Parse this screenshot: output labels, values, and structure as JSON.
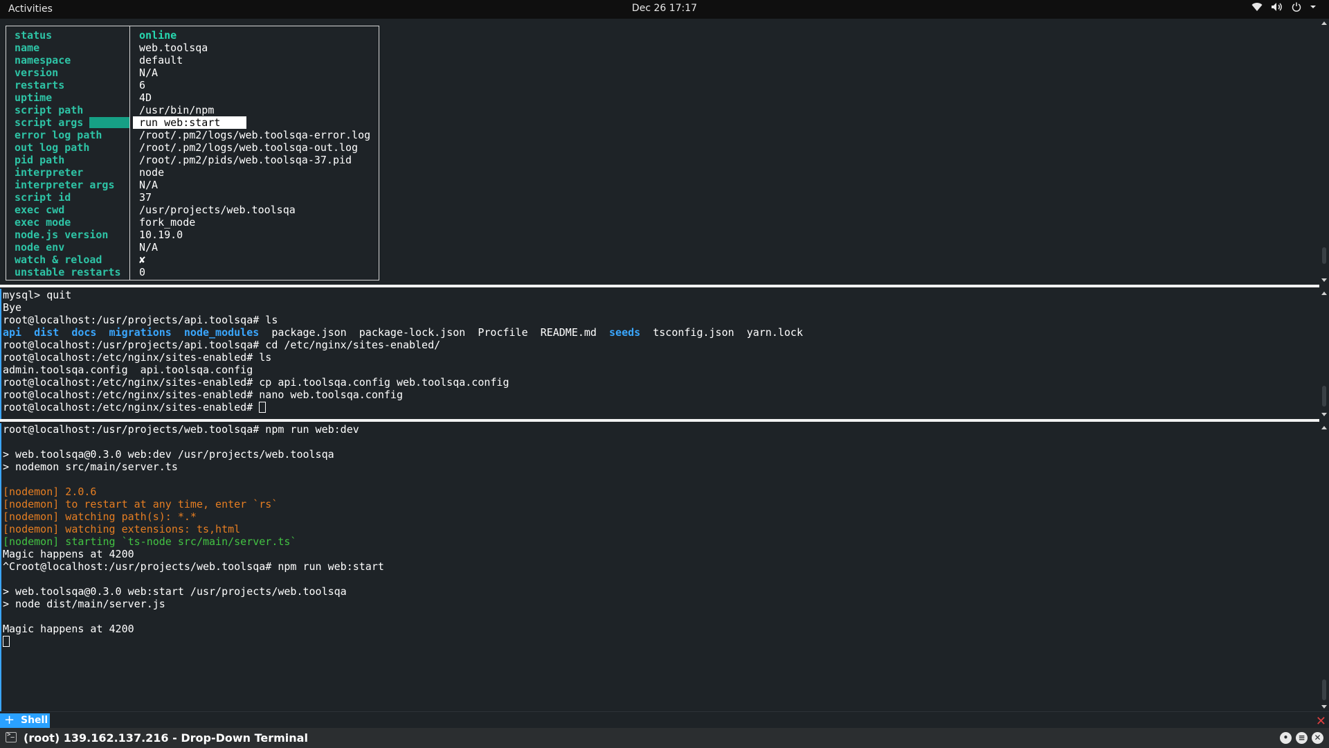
{
  "topbar": {
    "activities": "Activities",
    "clock": "Dec 26  17:17",
    "tray_icons": [
      "wifi-icon",
      "volume-icon",
      "power-icon",
      "chevron-down-icon"
    ]
  },
  "pm2_info": [
    {
      "key": "status",
      "value": "online"
    },
    {
      "key": "name",
      "value": "web.toolsqa"
    },
    {
      "key": "namespace",
      "value": "default"
    },
    {
      "key": "version",
      "value": "N/A"
    },
    {
      "key": "restarts",
      "value": "6"
    },
    {
      "key": "uptime",
      "value": "4D"
    },
    {
      "key": "script path",
      "value": "/usr/bin/npm"
    },
    {
      "key": "script args",
      "value": "run web:start"
    },
    {
      "key": "error log path",
      "value": "/root/.pm2/logs/web.toolsqa-error.log"
    },
    {
      "key": "out log path",
      "value": "/root/.pm2/logs/web.toolsqa-out.log"
    },
    {
      "key": "pid path",
      "value": "/root/.pm2/pids/web.toolsqa-37.pid"
    },
    {
      "key": "interpreter",
      "value": "node"
    },
    {
      "key": "interpreter args",
      "value": "N/A"
    },
    {
      "key": "script id",
      "value": "37"
    },
    {
      "key": "exec cwd",
      "value": "/usr/projects/web.toolsqa"
    },
    {
      "key": "exec mode",
      "value": "fork_mode"
    },
    {
      "key": "node.js version",
      "value": "10.19.0"
    },
    {
      "key": "node env",
      "value": "N/A"
    },
    {
      "key": "watch & reload",
      "value": "✘"
    },
    {
      "key": "unstable restarts",
      "value": "0"
    }
  ],
  "pane2": {
    "lines": [
      "mysql> quit",
      "Bye",
      "root@localhost:/usr/projects/api.toolsqa# ls",
      "root@localhost:/usr/projects/api.toolsqa# cd /etc/nginx/sites-enabled/",
      "root@localhost:/etc/nginx/sites-enabled# ls",
      "admin.toolsqa.config  api.toolsqa.config",
      "root@localhost:/etc/nginx/sites-enabled# cp api.toolsqa.config web.toolsqa.config",
      "root@localhost:/etc/nginx/sites-enabled# nano web.toolsqa.config",
      "root@localhost:/etc/nginx/sites-enabled# "
    ],
    "ls_entries": [
      {
        "name": "api",
        "dir": true
      },
      {
        "name": "dist",
        "dir": true
      },
      {
        "name": "docs",
        "dir": true
      },
      {
        "name": "migrations",
        "dir": true
      },
      {
        "name": "node_modules",
        "dir": true
      },
      {
        "name": "package.json",
        "dir": false
      },
      {
        "name": "package-lock.json",
        "dir": false
      },
      {
        "name": "Procfile",
        "dir": false
      },
      {
        "name": "README.md",
        "dir": false
      },
      {
        "name": "seeds",
        "dir": true
      },
      {
        "name": "tsconfig.json",
        "dir": false
      },
      {
        "name": "yarn.lock",
        "dir": false
      }
    ]
  },
  "pane3": {
    "lines": [
      "root@localhost:/usr/projects/web.toolsqa# npm run web:dev",
      "",
      "> web.toolsqa@0.3.0 web:dev /usr/projects/web.toolsqa",
      "> nodemon src/main/server.ts",
      "",
      "[nodemon] 2.0.6",
      "[nodemon] to restart at any time, enter `rs`",
      "[nodemon] watching path(s): *.*",
      "[nodemon] watching extensions: ts,html",
      "[nodemon] starting `ts-node src/main/server.ts`",
      "Magic happens at 4200",
      "^Croot@localhost:/usr/projects/web.toolsqa# npm run web:start",
      "",
      "> web.toolsqa@0.3.0 web:start /usr/projects/web.toolsqa",
      "> node dist/main/server.js",
      "",
      "Magic happens at 4200"
    ],
    "colors": {
      "nodemon_orange": "#e67e22",
      "nodemon_green": "#43c343"
    }
  },
  "tabbar": {
    "tab_label": "Shell",
    "add_icon": "plus-icon",
    "close_icon": "close-icon"
  },
  "window": {
    "title": "(root) 139.162.137.216 - Drop-Down Terminal",
    "terminal_icon": "terminal-icon",
    "controls": [
      "settings-icon",
      "menu-icon",
      "close-icon"
    ]
  },
  "colors": {
    "background": "#1e2327",
    "accent": "#2aa1ff",
    "pm2_key": "#2ec4a6",
    "pm2_online": "#27d9b0",
    "directory": "#3aa7ff"
  }
}
